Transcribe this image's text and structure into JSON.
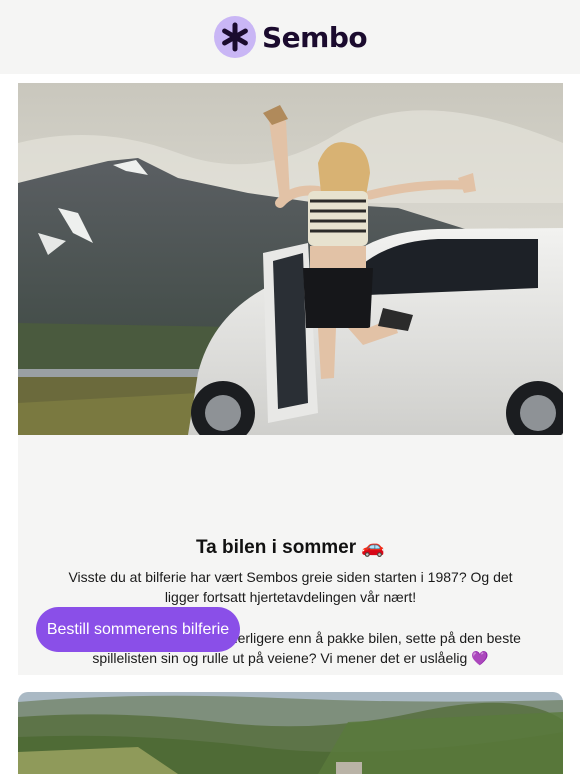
{
  "brand": {
    "name": "Sembo",
    "logo_icon": "asterisk-logo-icon",
    "accent": "#8a4fe8",
    "logo_bg": "#c9b6f5"
  },
  "card": {
    "hero_image": "woman-jumping-by-car-mountains-photo",
    "title": "Ta bilen i sommer 🚗",
    "paragraph1": "Visste du at bilferie har vært Sembos greie siden starten i 1987? Og det ligger fortsatt hjertetavdelingen vår nært!",
    "paragraph2": "For finnes det egentlig noe herligere enn å pakke bilen, sette på den beste spillelisten sin og rulle ut på veiene? Vi mener det er uslåelig 💜",
    "cta_label": "Bestill sommerens bilferie"
  },
  "next_card": {
    "hero_image": "rolling-hills-landscape-photo"
  }
}
